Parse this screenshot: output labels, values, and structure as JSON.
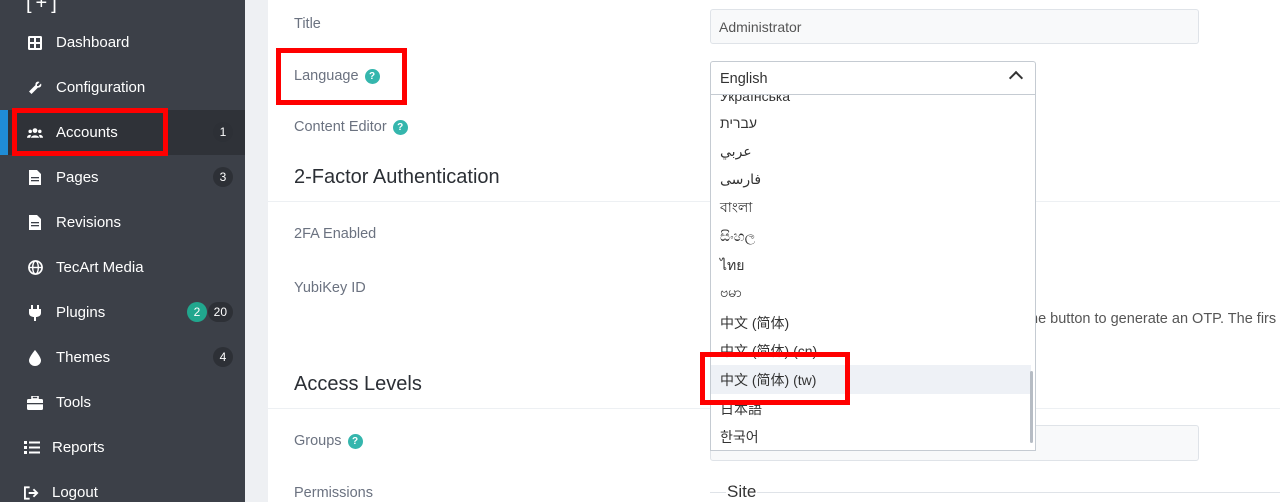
{
  "sidebar": {
    "top_glyph": "[+]",
    "items": [
      {
        "label": "Dashboard",
        "icon": "dashboard-icon"
      },
      {
        "label": "Configuration",
        "icon": "wrench-icon"
      },
      {
        "label": "Accounts",
        "icon": "users-icon",
        "badge": "1"
      },
      {
        "label": "Pages",
        "icon": "page-icon",
        "badge": "3"
      },
      {
        "label": "Revisions",
        "icon": "revisions-icon"
      },
      {
        "label": "TecArt Media",
        "icon": "globe-icon"
      },
      {
        "label": "Plugins",
        "icon": "plug-icon",
        "badge_green": "2",
        "badge": "20"
      },
      {
        "label": "Themes",
        "icon": "drop-icon",
        "badge": "4"
      },
      {
        "label": "Tools",
        "icon": "toolbox-icon"
      },
      {
        "label": "Reports",
        "icon": "list-icon"
      },
      {
        "label": "Logout",
        "icon": "logout-icon"
      }
    ]
  },
  "form": {
    "title_label": "Title",
    "title_value": "Administrator",
    "language_label": "Language",
    "language_selected": "English",
    "content_editor_label": "Content Editor",
    "twofa_section": "2-Factor Authentication",
    "twofa_enabled_label": "2FA Enabled",
    "yubikey_label": "YubiKey ID",
    "yubikey_help": "he button to generate an OTP. The firs",
    "access_levels_section": "Access Levels",
    "groups_label": "Groups",
    "permissions_label": "Permissions",
    "site_legend": "Site",
    "help_glyph": "?"
  },
  "dropdown": {
    "options": [
      "Українська",
      "עברית",
      "عربي",
      "فارسی",
      "বাংলা",
      "සිංහල",
      "ไทย",
      "ဗမာ",
      "中文 (简体)",
      "中文 (简体) (cn)",
      "中文 (简体) (tw)",
      "日本語",
      "한국어"
    ]
  },
  "colors": {
    "sidebar_bg": "#3c4048",
    "accent": "#1f8dd6",
    "help_badge": "#35b6ad",
    "plugins_badge": "#21a78e",
    "annotation": "#ff0000"
  }
}
